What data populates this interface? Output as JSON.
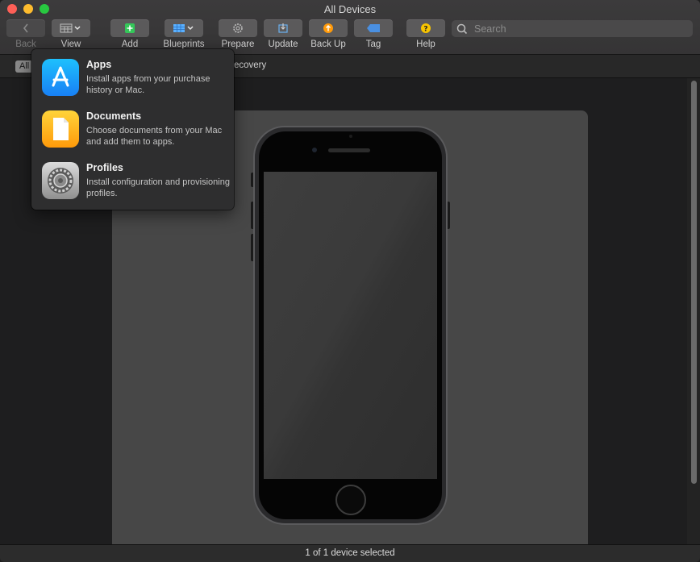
{
  "window": {
    "title": "All Devices"
  },
  "toolbar": {
    "back": "Back",
    "view": "View",
    "add": "Add",
    "blueprints": "Blueprints",
    "prepare": "Prepare",
    "update": "Update",
    "backup": "Back Up",
    "tag": "Tag",
    "help": "Help"
  },
  "search": {
    "placeholder": "Search"
  },
  "filterbar": {
    "all": "All",
    "recovery": "ecovery"
  },
  "popover": {
    "items": [
      {
        "title": "Apps",
        "description": "Install apps from your purchase history or Mac."
      },
      {
        "title": "Documents",
        "description": "Choose documents from your Mac and add them to apps."
      },
      {
        "title": "Profiles",
        "description": "Install configuration and provisioning profiles."
      }
    ]
  },
  "status": {
    "text": "1 of 1 device selected"
  },
  "colors": {
    "accent_orange": "#ff9a0a",
    "tag_blue": "#4a90e2",
    "help_yellow": "#f7c400"
  }
}
